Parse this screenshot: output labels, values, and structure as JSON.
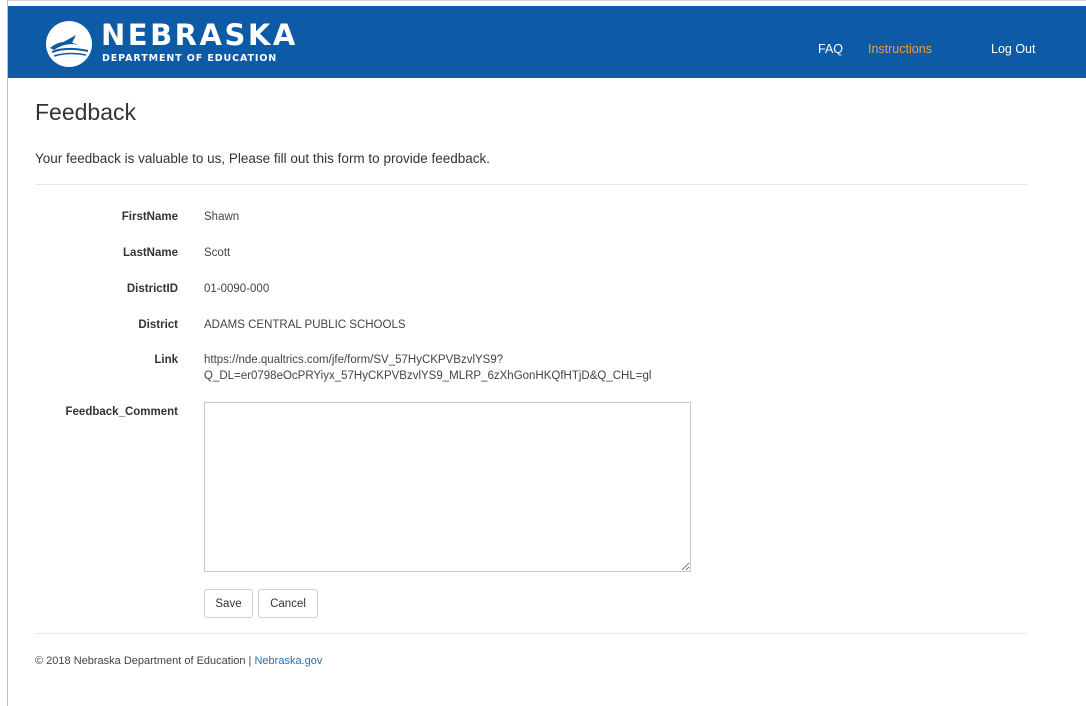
{
  "header": {
    "logo_title": "NEBRASKA",
    "logo_subtitle": "DEPARTMENT OF EDUCATION",
    "nav": {
      "faq": "FAQ",
      "instructions": "Instructions",
      "logout": "Log Out"
    },
    "colors": {
      "bar": "#0d5aa7",
      "active_link": "#f0a030"
    }
  },
  "page": {
    "title": "Feedback",
    "intro": "Your feedback is valuable to us, Please fill out this form to provide feedback."
  },
  "form": {
    "first_name": {
      "label": "FirstName",
      "value": "Shawn"
    },
    "last_name": {
      "label": "LastName",
      "value": "Scott"
    },
    "district_id": {
      "label": "DistrictID",
      "value": "01-0090-000"
    },
    "district": {
      "label": "District",
      "value": "ADAMS CENTRAL PUBLIC SCHOOLS"
    },
    "link": {
      "label": "Link",
      "value_line1": "https://nde.qualtrics.com/jfe/form/SV_57HyCKPVBzvlYS9?",
      "value_line2": "Q_DL=er0798eOcPRYiyx_57HyCKPVBzvlYS9_MLRP_6zXhGonHKQfHTjD&Q_CHL=gl"
    },
    "feedback_comment": {
      "label": "Feedback_Comment",
      "value": ""
    },
    "save_label": "Save",
    "cancel_label": "Cancel"
  },
  "footer": {
    "copyright": "© 2018 Nebraska Department of Education | ",
    "link_text": "Nebraska.gov"
  }
}
